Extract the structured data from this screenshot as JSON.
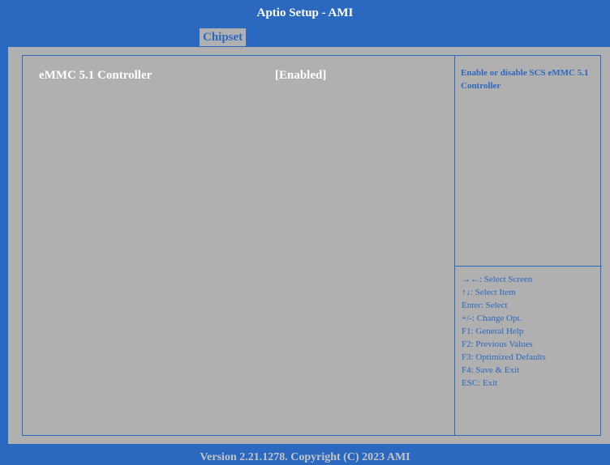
{
  "title": "Aptio Setup  - AMI",
  "tabs": [
    {
      "label": "Chipset",
      "active": true
    }
  ],
  "settings": [
    {
      "label": "eMMC 5.1 Controller",
      "value": "[Enabled]"
    }
  ],
  "help_text": "Enable or disable SCS eMMC 5.1 Controller",
  "key_help": [
    "→←: Select Screen",
    "↑↓: Select Item",
    "Enter: Select",
    "+/-: Change Opt.",
    "F1: General Help",
    "F2: Previous Values",
    "F3: Optimized Defaults",
    "F4: Save & Exit",
    "ESC: Exit"
  ],
  "footer": "Version 2.21.1278. Copyright (C) 2023 AMI",
  "colors": {
    "bios_blue": "#2b68c0",
    "panel_gray": "#b0b0b0",
    "highlight_text": "#ffffff",
    "footer_text": "#c4c4c4"
  }
}
